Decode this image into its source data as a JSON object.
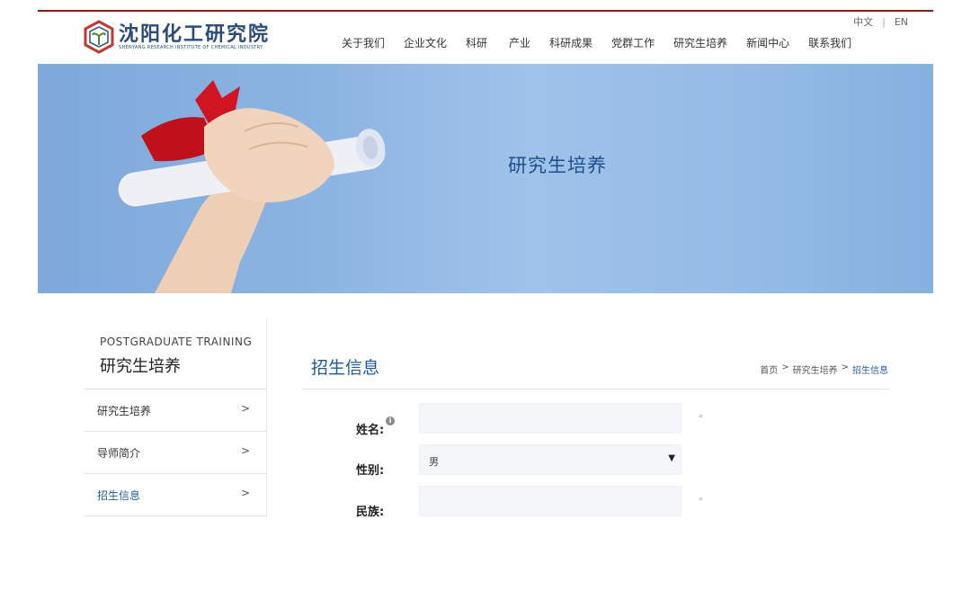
{
  "header": {
    "logo_cn": "沈阳化工研究院",
    "logo_en": "SHENYANG RESEARCH INSTITUTE OF CHEMICAL INDUSTRY",
    "lang": [
      "中文",
      "EN"
    ],
    "nav": [
      "关于我们",
      "企业文化",
      "科研",
      "产业",
      "科研成果",
      "党群工作",
      "研究生培养",
      "新闻中心",
      "联系我们"
    ]
  },
  "banner": {
    "title": "研究生培养"
  },
  "sidebar": {
    "title_en": "POSTGRADUATE TRAINING",
    "title_cn": "研究生培养",
    "items": [
      {
        "label": "研究生培养",
        "arrow": ">"
      },
      {
        "label": "导师简介",
        "arrow": ">"
      },
      {
        "label": "招生信息",
        "arrow": ">",
        "active": true
      }
    ]
  },
  "main": {
    "title": "招生信息",
    "breadcrumb": [
      "首页",
      "研究生培养",
      "招生信息"
    ],
    "breadcrumb_sep": ">",
    "form": {
      "name_label": "姓名:",
      "name_value": "",
      "gender_label": "性别:",
      "gender_value": "男",
      "ethnicity_label": "民族:",
      "ethnicity_value": "",
      "required_mark": "*"
    }
  },
  "colors": {
    "accent": "#1e5a96",
    "top_rule": "#8b1a1a",
    "banner": "#8bb3e1"
  }
}
